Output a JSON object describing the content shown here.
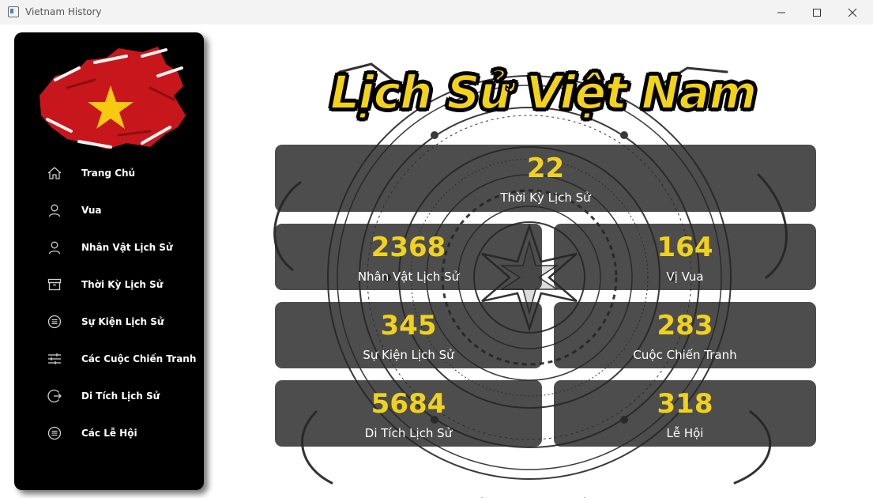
{
  "window": {
    "title": "Vietnam History"
  },
  "sidebar": {
    "items": [
      {
        "label": "Trang Chủ",
        "icon": "home-icon"
      },
      {
        "label": "Vua",
        "icon": "user-icon"
      },
      {
        "label": "Nhân Vật Lịch Sử",
        "icon": "user-icon"
      },
      {
        "label": "Thời Kỳ Lịch Sử",
        "icon": "archive-icon"
      },
      {
        "label": "Sự Kiện Lịch Sử",
        "icon": "list-circle-icon"
      },
      {
        "label": "Các Cuộc Chiến Tranh",
        "icon": "sliders-icon"
      },
      {
        "label": "Di Tích Lịch Sử",
        "icon": "exit-circle-icon"
      },
      {
        "label": "Các Lễ Hội",
        "icon": "list-circle-icon"
      }
    ]
  },
  "main": {
    "title": "Lịch Sử Việt Nam",
    "stats": [
      {
        "value": "22",
        "label": "Thời Kỳ Lịch Sử"
      },
      {
        "value": "2368",
        "label": "Nhân Vật Lịch Sử"
      },
      {
        "value": "164",
        "label": "Vị Vua"
      },
      {
        "value": "345",
        "label": "Sự Kiện Lịch Sử"
      },
      {
        "value": "283",
        "label": "Cuộc Chiến Tranh"
      },
      {
        "value": "5684",
        "label": "Di Tích Lịch Sử"
      },
      {
        "value": "318",
        "label": "Lễ Hội"
      }
    ]
  },
  "colors": {
    "accent": "#f0d21e",
    "sidebar_bg": "#000000",
    "card_bg": "#2c2c2c",
    "flag_red": "#c8161d",
    "flag_star": "#f7c910"
  }
}
